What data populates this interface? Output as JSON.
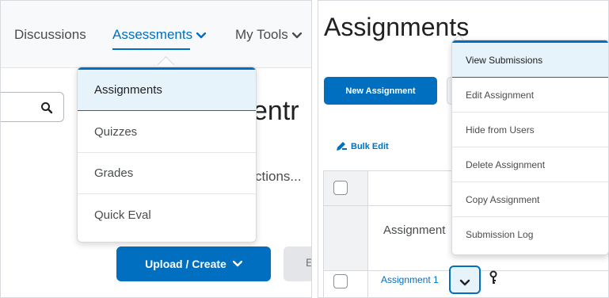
{
  "left_panel": {
    "nav": {
      "discussions": "Discussions",
      "assessments": "Assessments",
      "my_tools": "My Tools"
    },
    "background": {
      "heading_fragment": "entr",
      "text_fragment": "ctions...",
      "upload_label": "Upload / Create",
      "ghost_letter": "E"
    },
    "dropdown": {
      "items": [
        "Assignments",
        "Quizzes",
        "Grades",
        "Quick Eval"
      ]
    }
  },
  "right_panel": {
    "title": "Assignments",
    "new_button": "New Assignment",
    "bulk_edit": "Bulk Edit",
    "column_header": "Assignment",
    "row_link": "Assignment 1",
    "context_menu": {
      "items": [
        "View Submissions",
        "Edit Assignment",
        "Hide from Users",
        "Delete Assignment",
        "Copy Assignment",
        "Submission Log"
      ]
    }
  },
  "colors": {
    "accent": "#006fbf",
    "highlight": "#e6f3fb",
    "text": "#494c4e",
    "border": "#d6d9dd"
  }
}
